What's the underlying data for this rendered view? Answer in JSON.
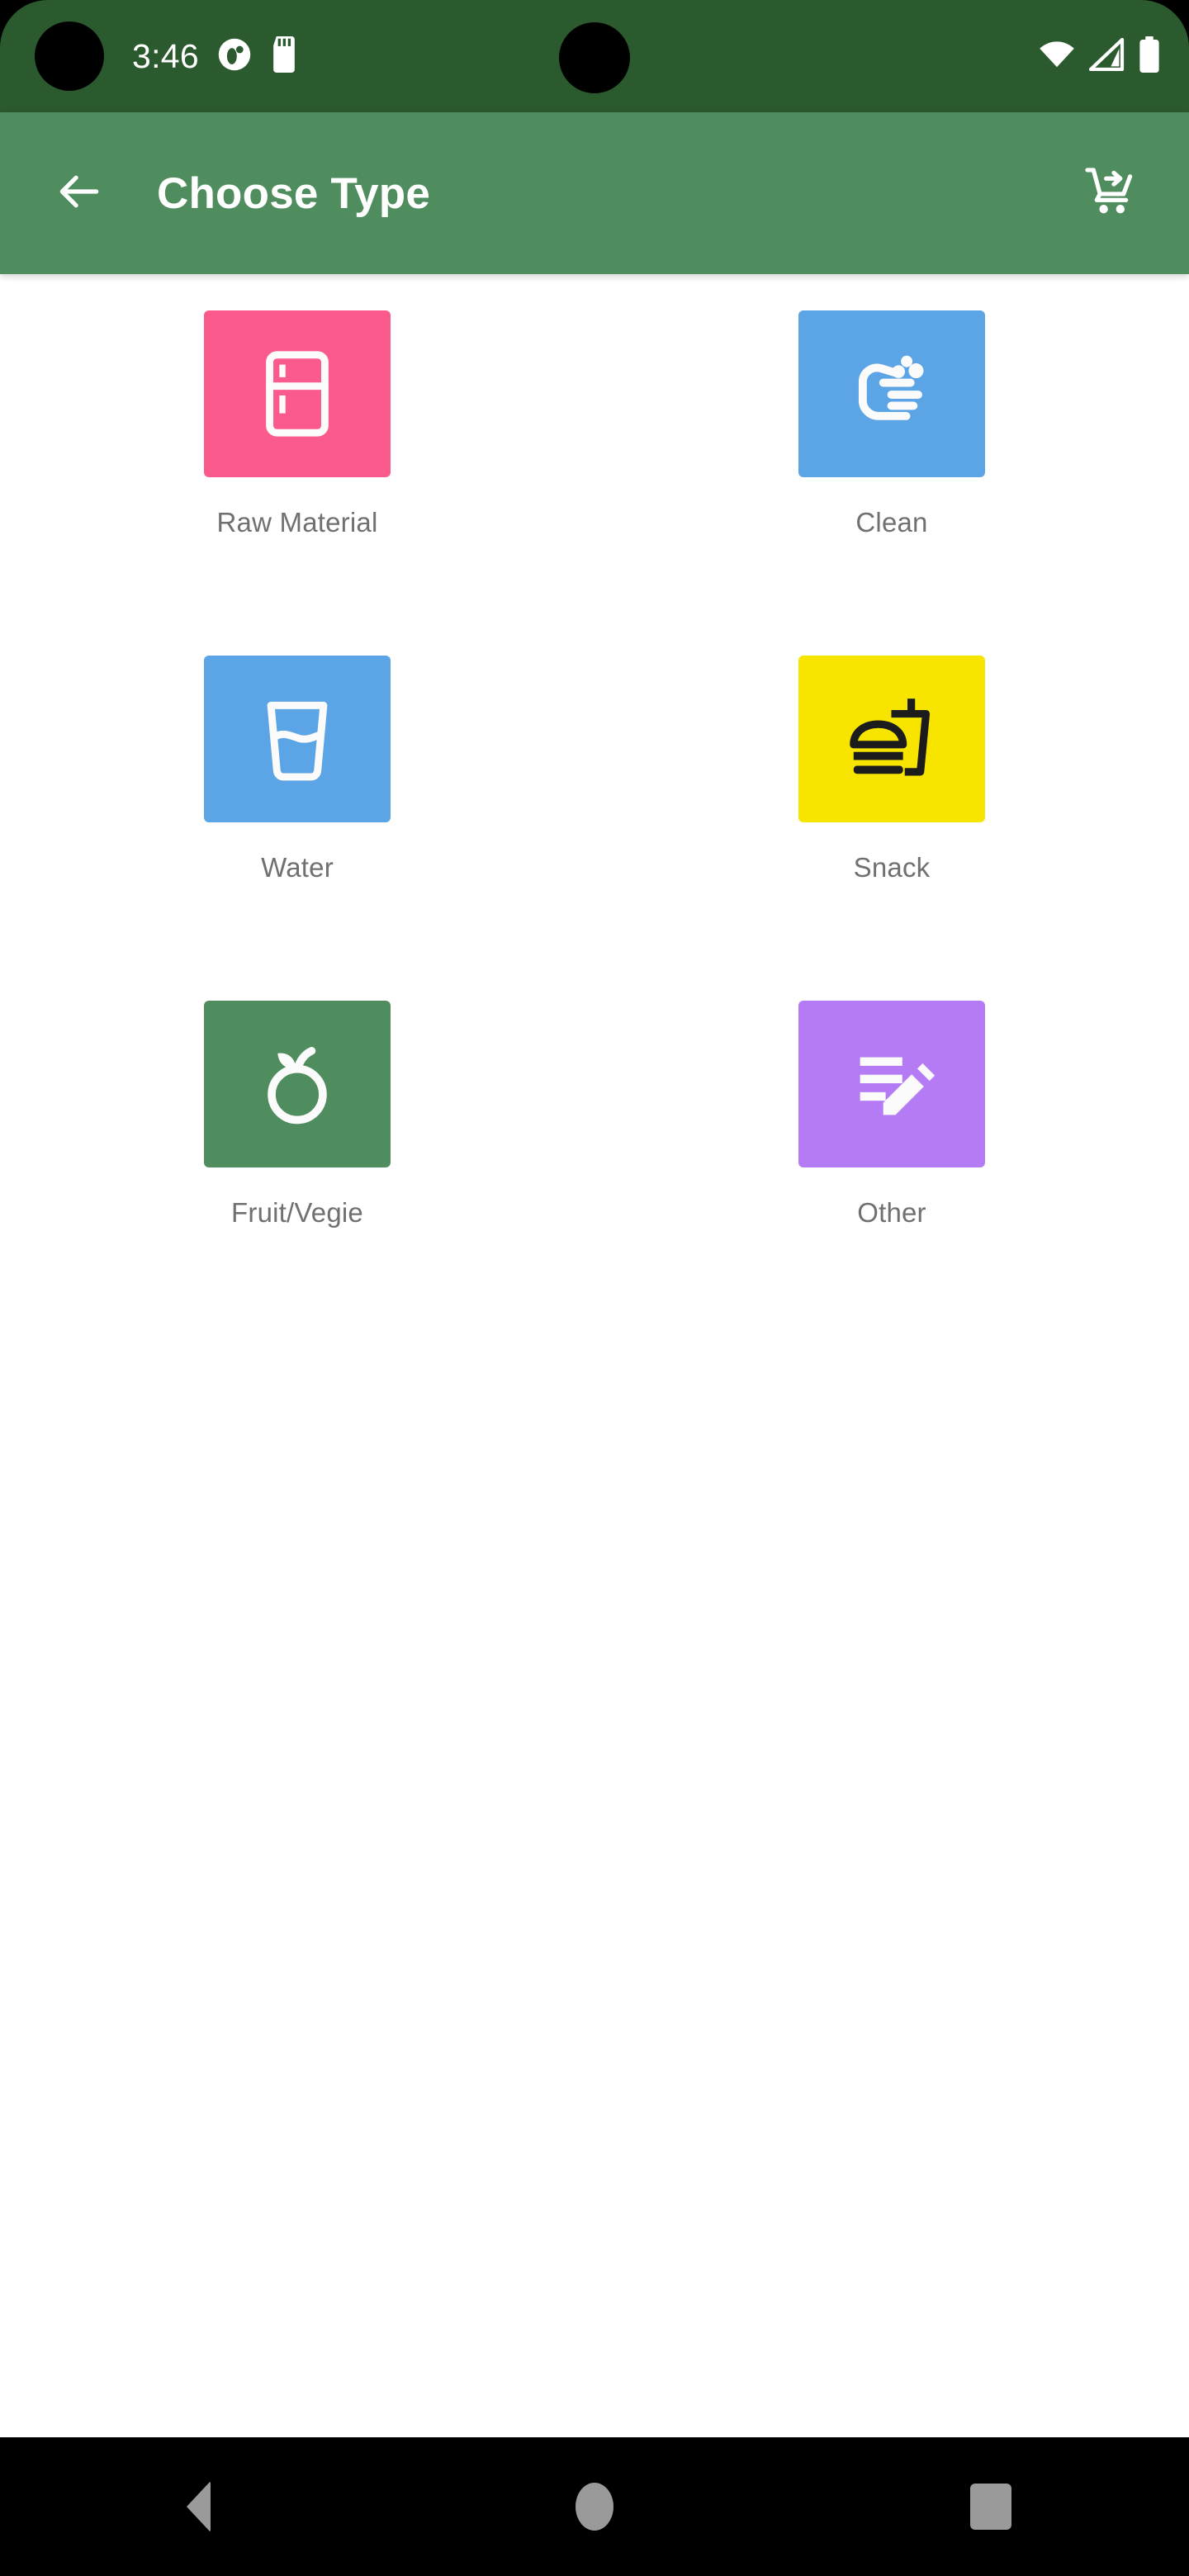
{
  "status_bar": {
    "time": "3:46",
    "background_color": "#2b5a2f",
    "icons": [
      {
        "name": "app-notification-icon",
        "label": "app-notification"
      },
      {
        "name": "sd-card-icon",
        "label": "sd-card"
      },
      {
        "name": "wifi-icon",
        "label": "wifi"
      },
      {
        "name": "cellular-signal-icon",
        "label": "cellular-signal"
      },
      {
        "name": "battery-icon",
        "label": "battery-full"
      }
    ]
  },
  "app_bar": {
    "title": "Choose Type",
    "background_color": "#4f8c5e",
    "back_icon": "arrow-back-icon",
    "cart_icon": "cart-forward-icon"
  },
  "grid": {
    "items": [
      {
        "label": "Raw Material",
        "icon": "refrigerator-icon",
        "tile_color": "#fa5a8c",
        "glyph_color": "#fbfbfb"
      },
      {
        "label": "Clean",
        "icon": "wash-hands-icon",
        "tile_color": "#5ba4e5",
        "glyph_color": "#fbfbfb"
      },
      {
        "label": "Water",
        "icon": "water-glass-icon",
        "tile_color": "#5ba4e5",
        "glyph_color": "#fbfbfb"
      },
      {
        "label": "Snack",
        "icon": "fast-food-icon",
        "tile_color": "#f7e500",
        "glyph_color": "#1c1c1c"
      },
      {
        "label": "Fruit/Vegie",
        "icon": "apple-fruit-icon",
        "tile_color": "#4f8c5e",
        "glyph_color": "#fbfbfb"
      },
      {
        "label": "Other",
        "icon": "note-edit-icon",
        "tile_color": "#b47bf5",
        "glyph_color": "#fbfbfb"
      }
    ]
  },
  "nav_bar": {
    "background_color": "#000000",
    "buttons": [
      {
        "name": "nav-back-button",
        "icon": "triangle-back-icon"
      },
      {
        "name": "nav-home-button",
        "icon": "circle-home-icon"
      },
      {
        "name": "nav-recents-button",
        "icon": "square-recents-icon"
      }
    ]
  }
}
